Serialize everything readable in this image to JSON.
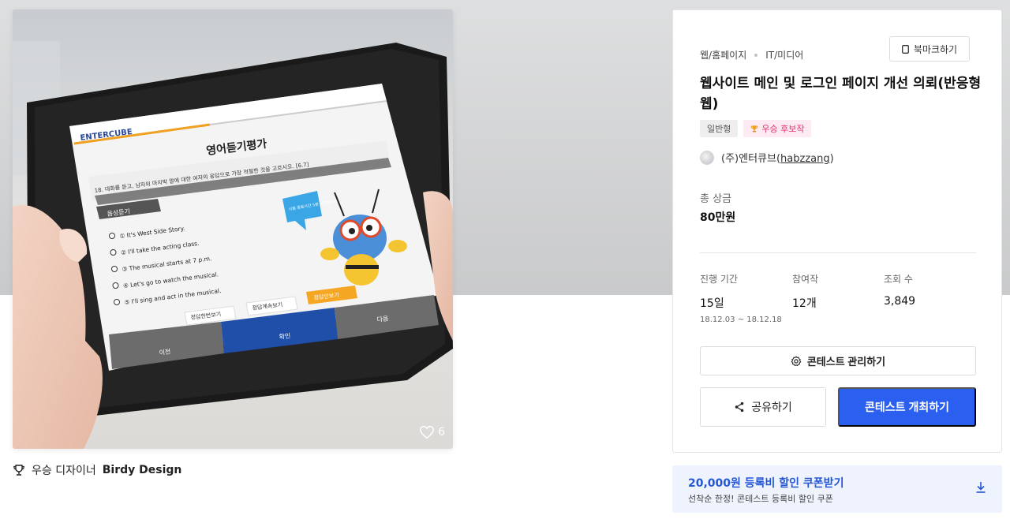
{
  "hero": {
    "likes": "6",
    "tablet": {
      "brand": "ENTERCUBE",
      "heading": "영어듣기평가",
      "question": "18. 대화를 듣고, 남자의 마지막 말에 대한 여자의 응답으로 가장 적절한 것을 고르시오. [6.7]",
      "audio_label": "음성듣기",
      "options": [
        "① It's West Side Story.",
        "② I'll take the acting class.",
        "③ The musical starts at 7 p.m.",
        "④ Let's go to watch the musical.",
        "⑤ I'll sing and act in the musical."
      ],
      "bubble": "시험 종료시간 5분 남았습니다",
      "buttons": [
        "정답한번보기",
        "정답계속보기",
        "정답안보기"
      ],
      "nav": {
        "prev": "이전",
        "confirm": "확인",
        "next": "다음"
      }
    }
  },
  "winner": {
    "prefix": "우승 디자이너",
    "name": "Birdy Design"
  },
  "card": {
    "category": "웹/홈페이지",
    "subcategory": "IT/미디어",
    "bookmark_label": "북마크하기",
    "title": "웹사이트 메인 및 로그인 페이지 개선 의뢰(반응형 웹)",
    "badge_type": "일반형",
    "badge_award": "우승 후보작",
    "org_name": "(주)엔터큐브",
    "org_id": "habzzang",
    "prize_label": "총 상금",
    "prize_value": "80만원",
    "stats": {
      "period_label": "진행 기간",
      "period_value": "15일",
      "period_range": "18.12.03 ~ 18.12.18",
      "entries_label": "참여작",
      "entries_value": "12개",
      "views_label": "조회 수",
      "views_value": "3,849"
    },
    "manage_label": "콘테스트 관리하기",
    "share_label": "공유하기",
    "host_label": "콘테스트 개최하기"
  },
  "coupon": {
    "title": "20,000원 등록비 할인 쿠폰받기",
    "subtitle": "선착순 한정! 콘테스트 등록비 할인 쿠폰"
  },
  "colors": {
    "primary": "#2a5ff0",
    "coupon_bg": "#eef3fd",
    "award_pink": "#e0336f"
  }
}
